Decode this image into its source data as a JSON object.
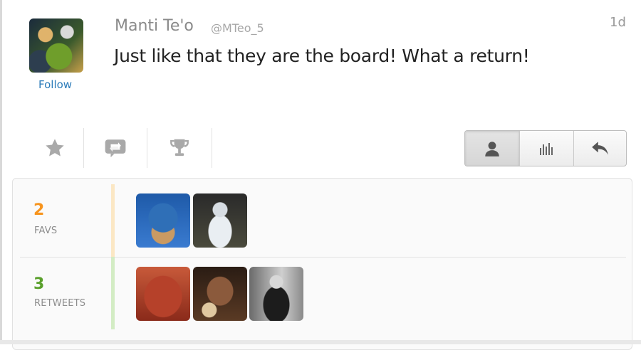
{
  "tweet": {
    "author_name": "Manti Te'o",
    "author_handle": "@MTeo_5",
    "time": "1d",
    "text": "Just like that they are the board! What a return!",
    "follow_label": "Follow"
  },
  "actions": {
    "left_icons": [
      "star-icon",
      "retweet-icon",
      "trophy-icon"
    ],
    "right_group_icons": [
      "person-icon",
      "bar-chart-icon",
      "reply-icon"
    ]
  },
  "stats": {
    "favs": {
      "count": "2",
      "label": "FAVS",
      "color": "#f7941d",
      "bar_color": "#fbe7c4",
      "users": 2
    },
    "retweets": {
      "count": "3",
      "label": "RETWEETS",
      "color": "#5aa02c",
      "bar_color": "#d3ecc4",
      "users": 3
    }
  },
  "colors": {
    "link": "#2b7bb9",
    "text": "#222222",
    "muted": "#8a8a8a"
  }
}
